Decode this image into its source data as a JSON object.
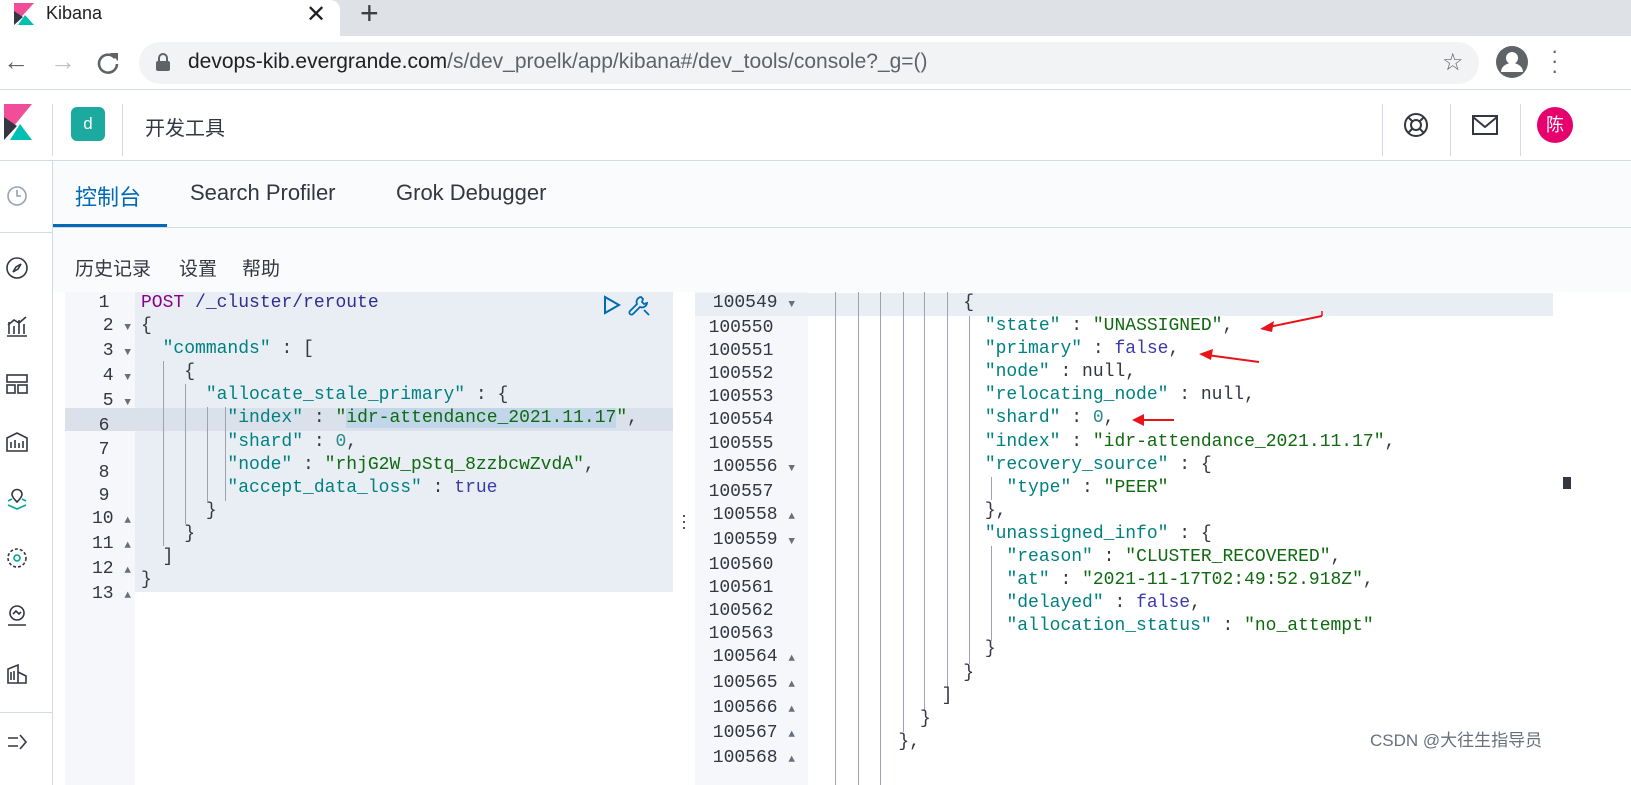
{
  "browser": {
    "tab_title": "Kibana",
    "tab_close": "✕",
    "new_tab": "+",
    "url_host": "devops-kib.evergrande.com",
    "url_path": "/s/dev_proelk/app/kibana#/dev_tools/console?_g=()"
  },
  "header": {
    "space_initial": "d",
    "breadcrumb": "开发工具",
    "user_initial": "陈"
  },
  "tabs": [
    {
      "label": "控制台",
      "active": true
    },
    {
      "label": "Search Profiler",
      "active": false
    },
    {
      "label": "Grok Debugger",
      "active": false
    }
  ],
  "menu": {
    "history": "历史记录",
    "settings": "设置",
    "help": "帮助"
  },
  "request": {
    "line_numbers": [
      "1",
      "2",
      "3",
      "4",
      "5",
      "6",
      "7",
      "8",
      "9",
      "10",
      "11",
      "12",
      "13"
    ],
    "method": "POST",
    "endpoint": "/_cluster/reroute",
    "commands_key": "\"commands\"",
    "command_name": "\"allocate_stale_primary\"",
    "index_key": "\"index\"",
    "index_value": "idr-attendance_2021.11.17",
    "shard_key": "\"shard\"",
    "shard_value": "0",
    "node_key": "\"node\"",
    "node_value": "\"rhjG2W_pStq_8zzbcwZvdA\"",
    "accept_key": "\"accept_data_loss\"",
    "accept_value": "true"
  },
  "response": {
    "line_numbers": [
      "100549",
      "100550",
      "100551",
      "100552",
      "100553",
      "100554",
      "100555",
      "100556",
      "100557",
      "100558",
      "100559",
      "100560",
      "100561",
      "100562",
      "100563",
      "100564",
      "100565",
      "100566",
      "100567",
      "100568"
    ],
    "state_key": "\"state\"",
    "state_value": "\"UNASSIGNED\"",
    "primary_key": "\"primary\"",
    "primary_value": "false",
    "node_key": "\"node\"",
    "node_value": "null",
    "relocating_key": "\"relocating_node\"",
    "relocating_value": "null",
    "shard_key": "\"shard\"",
    "shard_value": "0",
    "index_key": "\"index\"",
    "index_value": "\"idr-attendance_2021.11.17\"",
    "recovery_key": "\"recovery_source\"",
    "type_key": "\"type\"",
    "type_value": "\"PEER\"",
    "unassigned_key": "\"unassigned_info\"",
    "reason_key": "\"reason\"",
    "reason_value": "\"CLUSTER_RECOVERED\"",
    "at_key": "\"at\"",
    "at_value": "\"2021-11-17T02:49:52.918Z\"",
    "delayed_key": "\"delayed\"",
    "delayed_value": "false",
    "alloc_key": "\"allocation_status\"",
    "alloc_value": "\"no_attempt\""
  },
  "annotation_color": "#e8141a",
  "accent_color": "#006bb4",
  "watermark": "CSDN @大往生指导员"
}
